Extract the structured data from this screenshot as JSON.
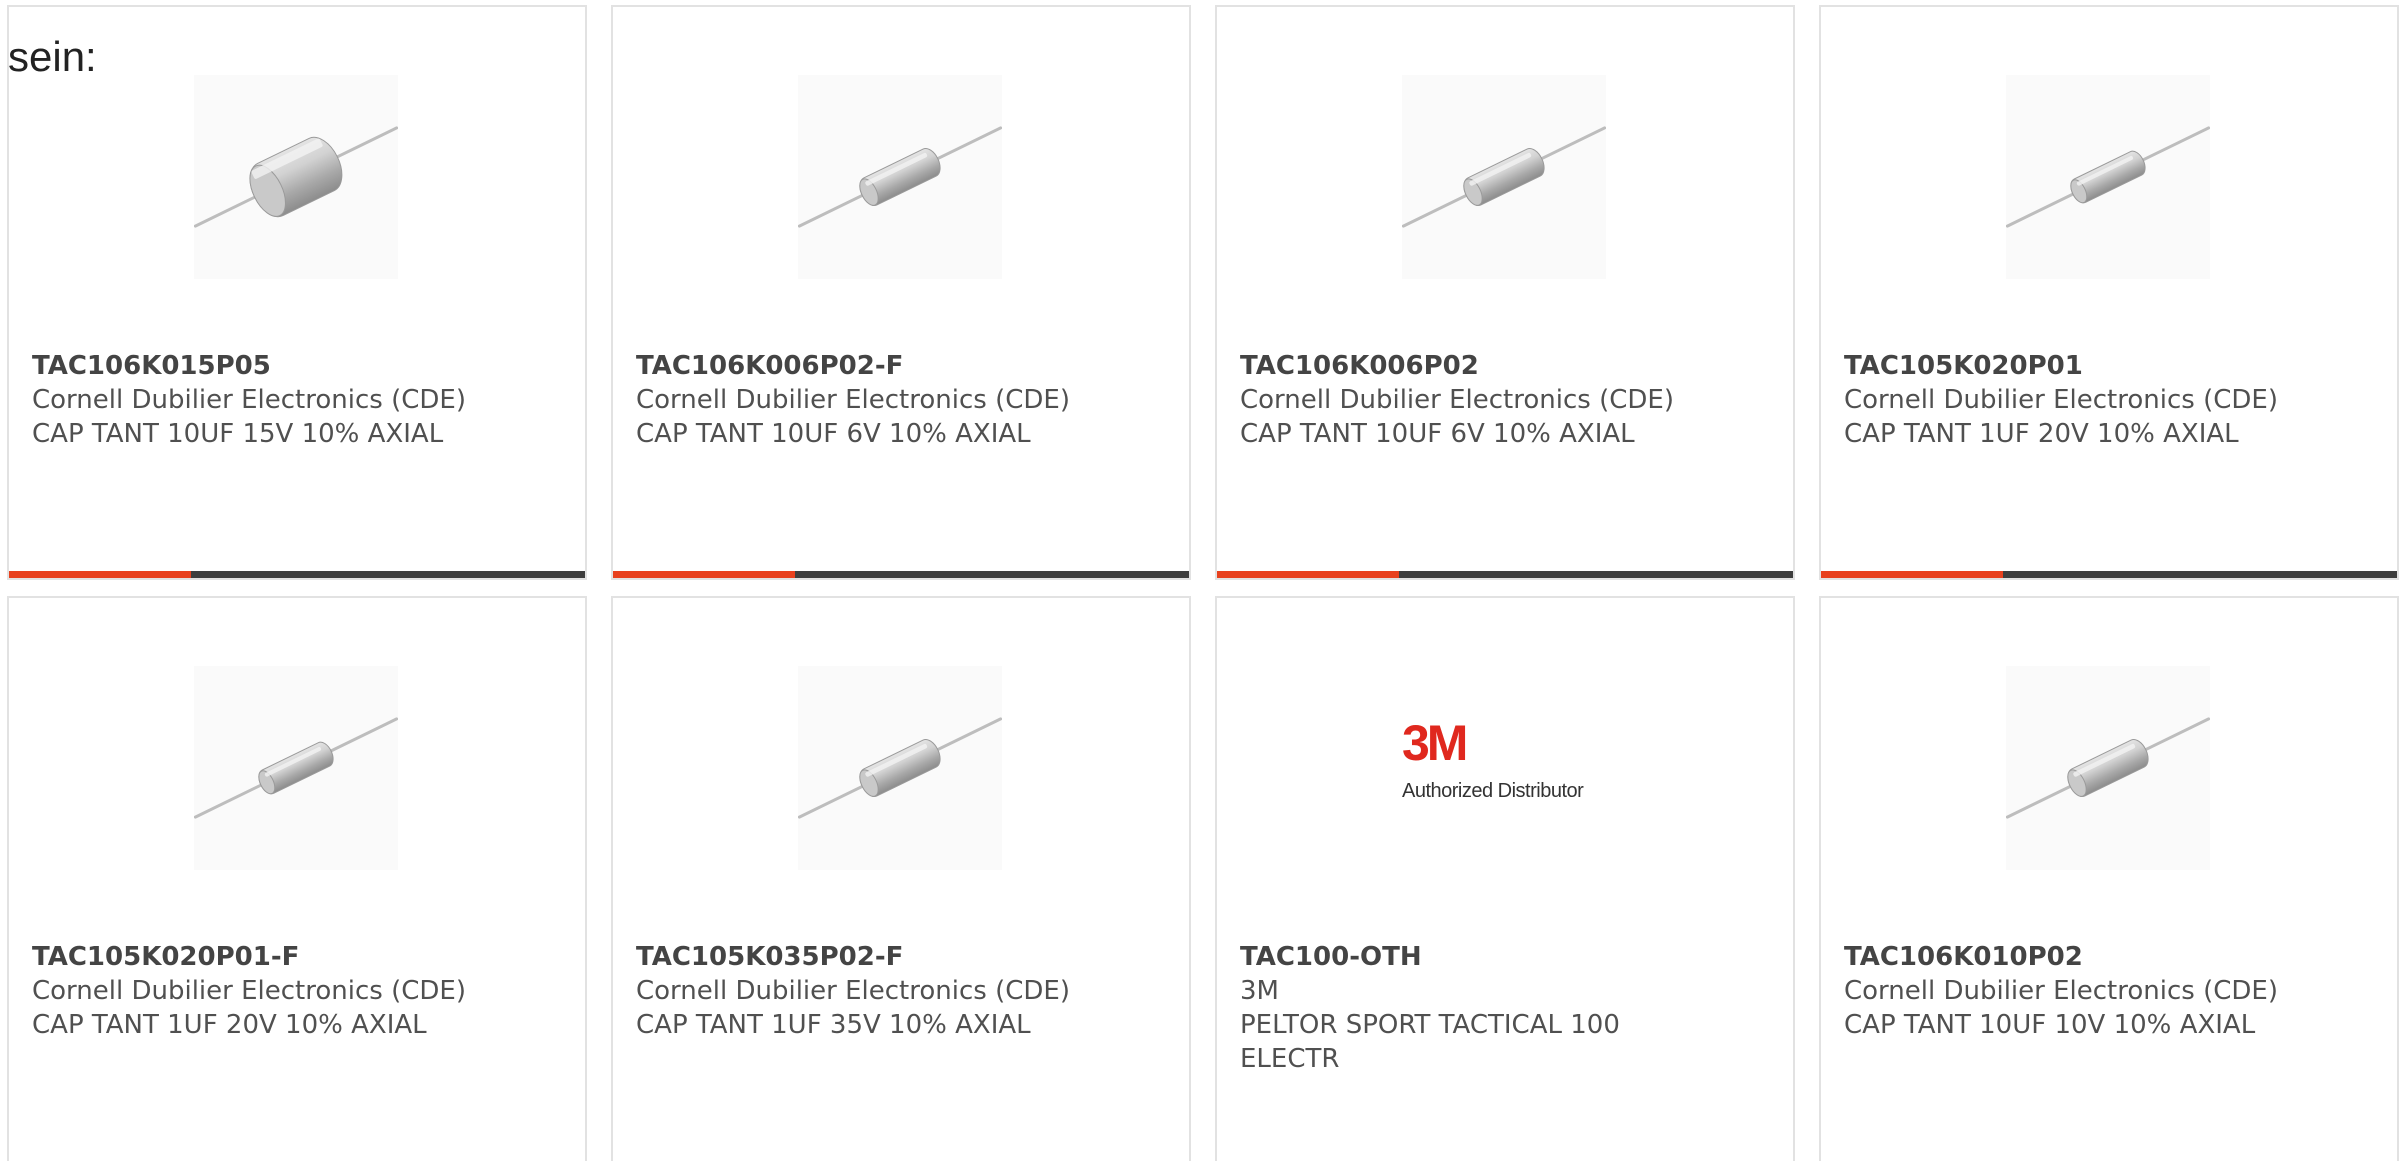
{
  "intro_text": "sein:",
  "colors": {
    "accent": "#e8411e",
    "bar": "#3e3e3e",
    "card_border": "#e2e2e2",
    "logo_red": "#e0281e"
  },
  "products": [
    {
      "part": "TAC106K015P05",
      "maker": "Cornell Dubilier Electronics (CDE)",
      "desc": "CAP TANT 10UF 15V 10% AXIAL",
      "image": "axial-capacitor-large"
    },
    {
      "part": "TAC106K006P02-F",
      "maker": "Cornell Dubilier Electronics (CDE)",
      "desc": "CAP TANT 10UF 6V 10% AXIAL",
      "image": "axial-capacitor"
    },
    {
      "part": "TAC106K006P02",
      "maker": "Cornell Dubilier Electronics (CDE)",
      "desc": "CAP TANT 10UF 6V 10% AXIAL",
      "image": "axial-capacitor"
    },
    {
      "part": "TAC105K020P01",
      "maker": "Cornell Dubilier Electronics (CDE)",
      "desc": "CAP TANT 1UF 20V 10% AXIAL",
      "image": "axial-capacitor-small"
    },
    {
      "part": "TAC105K020P01-F",
      "maker": "Cornell Dubilier Electronics (CDE)",
      "desc": "CAP TANT 1UF 20V 10% AXIAL",
      "image": "axial-capacitor-small"
    },
    {
      "part": "TAC105K035P02-F",
      "maker": "Cornell Dubilier Electronics (CDE)",
      "desc": "CAP TANT 1UF 35V 10% AXIAL",
      "image": "axial-capacitor"
    },
    {
      "part": "TAC100-OTH",
      "maker": "3M",
      "desc": "PELTOR SPORT TACTICAL 100 ELECTR",
      "image": "3m-logo",
      "logo_mark": "3M",
      "logo_sub": "Authorized Distributor"
    },
    {
      "part": "TAC106K010P02",
      "maker": "Cornell Dubilier Electronics (CDE)",
      "desc": "CAP TANT 10UF 10V 10% AXIAL",
      "image": "axial-capacitor"
    }
  ]
}
